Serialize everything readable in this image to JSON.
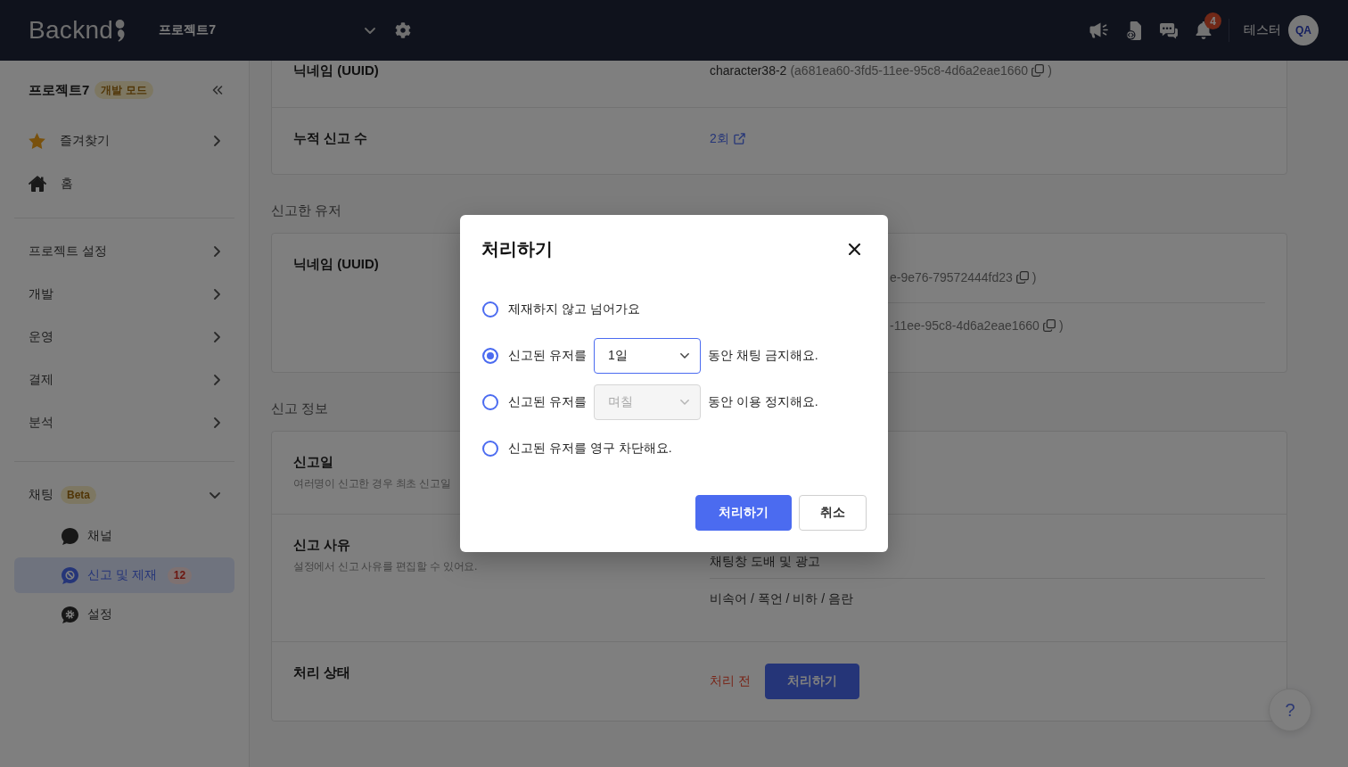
{
  "topbar": {
    "logo": "Backnd",
    "project_selector": "프로젝트7",
    "notification_count": "4",
    "user_name": "테스터",
    "avatar_initials": "QA"
  },
  "sidebar": {
    "project_name": "프로젝트7",
    "mode_badge": "개발 모드",
    "top_items": [
      {
        "label": "즐겨찾기",
        "kind": "menu"
      },
      {
        "label": "홈",
        "kind": "link"
      }
    ],
    "menu_items": [
      {
        "label": "프로젝트 설정",
        "expanded": false
      },
      {
        "label": "개발",
        "expanded": false
      },
      {
        "label": "운영",
        "expanded": false
      },
      {
        "label": "결제",
        "expanded": false
      },
      {
        "label": "분석",
        "expanded": false
      }
    ],
    "chat_group": {
      "label": "채팅",
      "badge": "Beta",
      "expanded": true,
      "children": [
        {
          "label": "채널",
          "selected": false
        },
        {
          "label": "신고 및 제재",
          "selected": true,
          "count": "12"
        },
        {
          "label": "설정",
          "selected": false
        }
      ]
    }
  },
  "account_card": {
    "rows": [
      {
        "kind": "uuid",
        "label": "닉네임 (UUID)",
        "name": "character38-2",
        "uuid": "(a681ea60-3fd5-11ee-95c8-4d6a2eae1660",
        "closing": ")"
      },
      {
        "kind": "link",
        "label": "누적 신고 수",
        "link": "2회"
      }
    ]
  },
  "reporter_section": {
    "title": "신고한 유저",
    "covered": true,
    "label": "닉네임 (UUID)",
    "values": [
      {
        "uuid": "e-9e76-79572444fd23",
        "closing": ")"
      },
      {
        "uuid": "-11ee-95c8-4d6a2eae1660",
        "closing": ")"
      }
    ]
  },
  "report_section": {
    "title": "신고 정보",
    "rows": [
      {
        "kind": "note",
        "label": "신고일",
        "description": "여러명이 신고한 경우 최초 신고일"
      },
      {
        "kind": "list",
        "label": "신고 사유",
        "description": "설정에서 신고 사유를 편집할 수 있어요.",
        "values": [
          "채팅창 도배 및 광고",
          "비속어 / 폭언 / 비하 / 음란"
        ]
      },
      {
        "kind": "status",
        "label": "처리 상태",
        "status": "처리 전",
        "action": "처리하기"
      }
    ]
  },
  "help_button": "?",
  "dialog": {
    "title": "처리하기",
    "options": [
      {
        "kind": "plain",
        "label": "제재하지 않고 넘어가요",
        "selected": false
      },
      {
        "kind": "duration",
        "prefix": "신고된 유저를",
        "select": {
          "value": "1일",
          "disabled": false
        },
        "suffix": "동안 채팅 금지해요.",
        "selected": true
      },
      {
        "kind": "duration",
        "prefix": "신고된 유저를",
        "select": {
          "placeholder": "며칠",
          "disabled": true
        },
        "suffix": "동안 이용 정지해요.",
        "selected": false
      },
      {
        "kind": "plain",
        "label": "신고된 유저를 영구 차단해요.",
        "selected": false
      }
    ],
    "buttons": [
      {
        "kind": "primary",
        "label": "처리하기"
      },
      {
        "kind": "secondary",
        "label": "취소"
      }
    ]
  }
}
